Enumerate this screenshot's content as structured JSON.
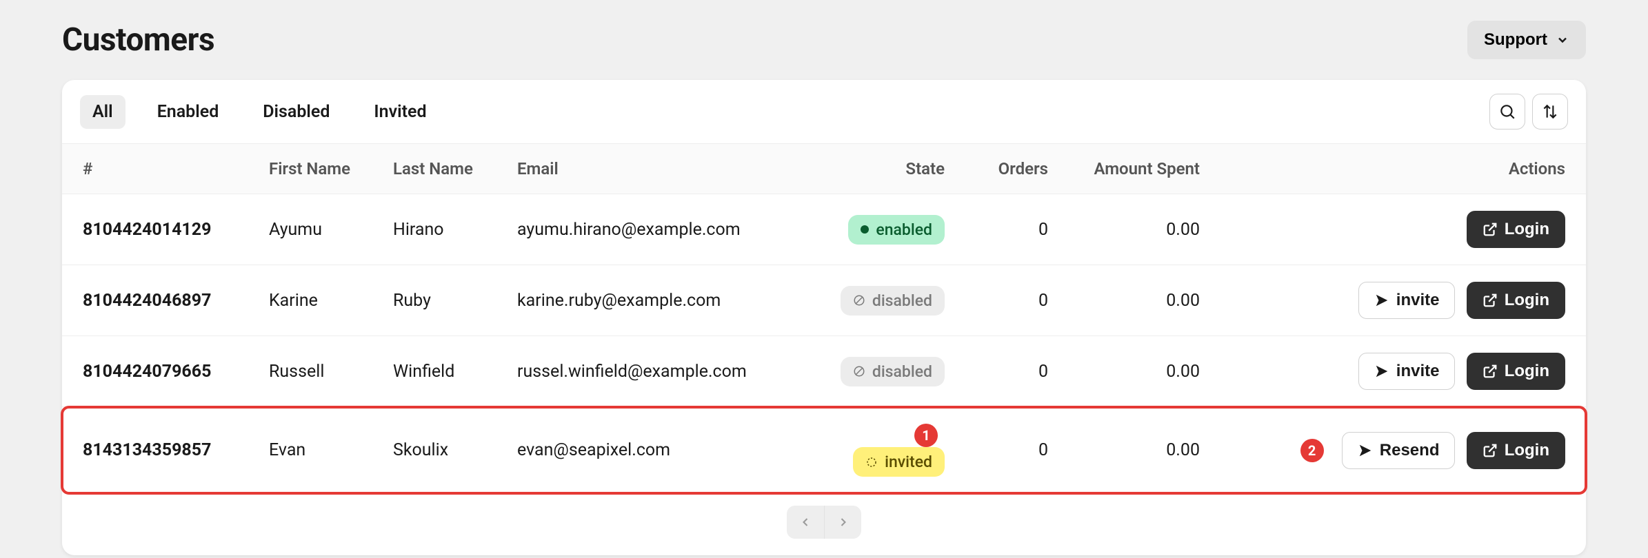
{
  "header": {
    "title": "Customers",
    "support_label": "Support"
  },
  "tabs": {
    "all": "All",
    "enabled": "Enabled",
    "disabled": "Disabled",
    "invited": "Invited"
  },
  "columns": {
    "id": "#",
    "first_name": "First Name",
    "last_name": "Last Name",
    "email": "Email",
    "state": "State",
    "orders": "Orders",
    "amount_spent": "Amount Spent",
    "actions": "Actions"
  },
  "badges": {
    "enabled": "enabled",
    "disabled": "disabled",
    "invited": "invited"
  },
  "buttons": {
    "invite": "invite",
    "resend": "Resend",
    "login": "Login"
  },
  "callouts": {
    "one": "1",
    "two": "2"
  },
  "rows": [
    {
      "id": "8104424014129",
      "first_name": "Ayumu",
      "last_name": "Hirano",
      "email": "ayumu.hirano@example.com",
      "state": "enabled",
      "orders": "0",
      "amount": "0.00"
    },
    {
      "id": "8104424046897",
      "first_name": "Karine",
      "last_name": "Ruby",
      "email": "karine.ruby@example.com",
      "state": "disabled",
      "orders": "0",
      "amount": "0.00"
    },
    {
      "id": "8104424079665",
      "first_name": "Russell",
      "last_name": "Winfield",
      "email": "russel.winfield@example.com",
      "state": "disabled",
      "orders": "0",
      "amount": "0.00"
    },
    {
      "id": "8143134359857",
      "first_name": "Evan",
      "last_name": "Skoulix",
      "email": "evan@seapixel.com",
      "state": "invited",
      "orders": "0",
      "amount": "0.00"
    }
  ]
}
